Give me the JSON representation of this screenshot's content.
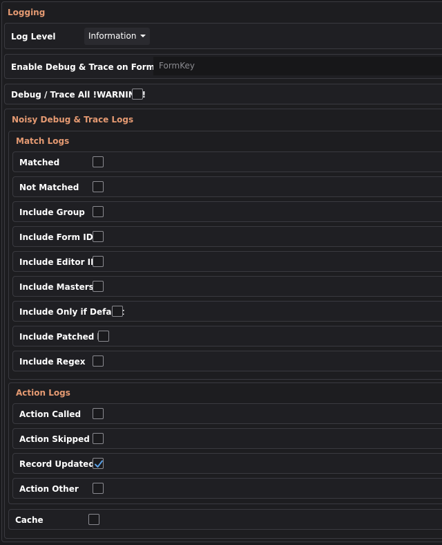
{
  "logging": {
    "title": "Logging",
    "log_level": {
      "label": "Log Level",
      "value": "Information"
    },
    "debug_formkey": {
      "label": "Enable Debug & Trace on Form Key",
      "placeholder": "FormKey"
    },
    "debug_all": {
      "label": "Debug / Trace All !WARNING!",
      "checked": false
    },
    "noisy": {
      "title": "Noisy Debug & Trace Logs",
      "match_logs": {
        "title": "Match Logs",
        "items": [
          {
            "label": "Matched",
            "checked": false
          },
          {
            "label": "Not Matched",
            "checked": false
          },
          {
            "label": "Include Group",
            "checked": false
          },
          {
            "label": "Include Form ID",
            "checked": false
          },
          {
            "label": "Include Editor ID",
            "checked": false
          },
          {
            "label": "Include Masters",
            "checked": false
          },
          {
            "label": "Include Only if Default",
            "checked": false
          },
          {
            "label": "Include Patched by",
            "checked": false
          },
          {
            "label": "Include Regex",
            "checked": false
          }
        ]
      },
      "action_logs": {
        "title": "Action Logs",
        "items": [
          {
            "label": "Action Called",
            "checked": false
          },
          {
            "label": "Action Skipped",
            "checked": false
          },
          {
            "label": "Record Updated",
            "checked": true
          },
          {
            "label": "Action Other",
            "checked": false
          }
        ]
      },
      "cache": {
        "label": "Cache",
        "checked": false
      }
    }
  },
  "colors": {
    "accent": "#e59a72",
    "check": "#5aa0e6",
    "background": "#1a1a1d"
  }
}
